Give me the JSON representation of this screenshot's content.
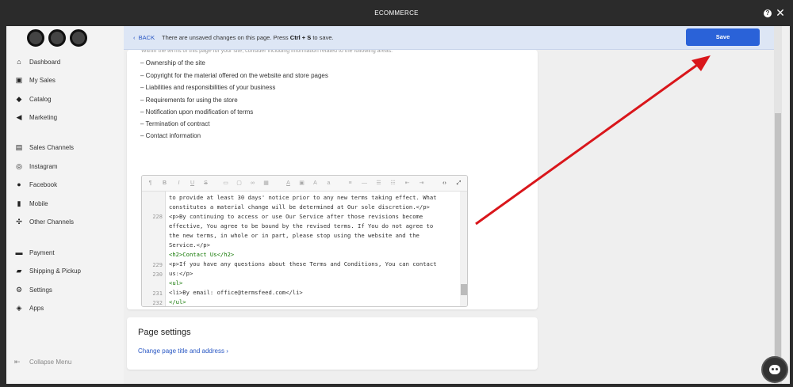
{
  "titlebar": {
    "title": "ECOMMERCE",
    "help": "?",
    "close": "✕"
  },
  "banner": {
    "back_label": "BACK",
    "message_pre": "There are unsaved changes on this page. Press ",
    "message_key": "Ctrl + S",
    "message_post": " to save.",
    "save_label": "Save"
  },
  "sidebar": {
    "items": [
      {
        "label": "Dashboard",
        "icon": "home-icon"
      },
      {
        "label": "My Sales",
        "icon": "sales-icon"
      },
      {
        "label": "Catalog",
        "icon": "tag-icon"
      },
      {
        "label": "Marketing",
        "icon": "megaphone-icon"
      },
      {
        "label": "Sales Channels",
        "icon": "channels-icon"
      },
      {
        "label": "Instagram",
        "icon": "instagram-icon"
      },
      {
        "label": "Facebook",
        "icon": "facebook-icon"
      },
      {
        "label": "Mobile",
        "icon": "mobile-icon"
      },
      {
        "label": "Other Channels",
        "icon": "share-icon"
      },
      {
        "label": "Payment",
        "icon": "payment-icon"
      },
      {
        "label": "Shipping & Pickup",
        "icon": "truck-icon"
      },
      {
        "label": "Settings",
        "icon": "gear-icon"
      },
      {
        "label": "Apps",
        "icon": "apps-icon"
      }
    ],
    "collapse_label": "Collapse Menu"
  },
  "content": {
    "faded_line": "Within the terms of this page for your site, consider including information related to the following areas:",
    "bullets": [
      "Ownership of the site",
      "Copyright for the material offered on the website and store pages",
      "Liabilities and responsibilities of your business",
      "Requirements for using the store",
      "Notification upon modification of terms",
      "Termination of contract",
      "Contact information"
    ]
  },
  "editor": {
    "lines": [
      {
        "ln": "",
        "text": "to provide at least 30 days' notice prior to any new terms taking effect. What"
      },
      {
        "ln": "",
        "text": "constitutes a material change will be determined at Our sole discretion.</p>"
      },
      {
        "ln": "228",
        "text": "<p>By continuing to access or use Our Service after those revisions become"
      },
      {
        "ln": "",
        "text": "effective, You agree to be bound by the revised terms. If You do not agree to"
      },
      {
        "ln": "",
        "text": "the new terms, in whole or in part, please stop using the website and the"
      },
      {
        "ln": "",
        "text": "Service.</p>"
      },
      {
        "ln": "229",
        "text": "<h2>Contact Us</h2>"
      },
      {
        "ln": "230",
        "text": "<p>If you have any questions about these Terms and Conditions, You can contact"
      },
      {
        "ln": "",
        "text": "us:</p>"
      },
      {
        "ln": "231",
        "text": "<ul>"
      },
      {
        "ln": "232",
        "text": "<li>By email: office@termsfeed.com</li>"
      },
      {
        "ln": "233",
        "text": "</ul>"
      }
    ]
  },
  "page_settings": {
    "heading": "Page settings",
    "link": "Change page title and address ›"
  },
  "colors": {
    "accent": "#2a62d8",
    "annotation_arrow": "#d9161b"
  }
}
